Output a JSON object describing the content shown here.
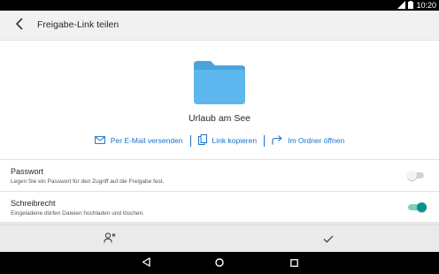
{
  "status_bar": {
    "time": "10:20",
    "icons": [
      "signal-icon",
      "battery-icon"
    ]
  },
  "app_bar": {
    "title": "Freigabe-Link teilen",
    "back_icon": "back-arrow-icon"
  },
  "share": {
    "folder_icon": "folder-icon",
    "folder_color": "#5db7ee",
    "folder_name": "Urlaub am See",
    "actions": [
      {
        "icon": "mail-icon",
        "label": "Per E-Mail versenden"
      },
      {
        "icon": "copy-icon",
        "label": "Link kopieren"
      },
      {
        "icon": "forward-arrow-icon",
        "label": "Im Ordner öffnen"
      }
    ],
    "accent_color": "#1a73c8"
  },
  "settings": [
    {
      "title": "Passwort",
      "subtitle": "Legen Sie ein Passwort für den Zugriff auf die Freigabe fest.",
      "enabled": false
    },
    {
      "title": "Schreibrecht",
      "subtitle": "Eingeladene dürfen Dateien hochladen und löschen.",
      "enabled": true
    }
  ],
  "switch_on_color": "#009688",
  "bottom_actions": {
    "left_icon": "remove-user-icon",
    "right_icon": "checkmark-icon"
  },
  "nav_bar": {
    "icons": [
      "nav-back-icon",
      "nav-home-icon",
      "nav-recents-icon"
    ]
  }
}
